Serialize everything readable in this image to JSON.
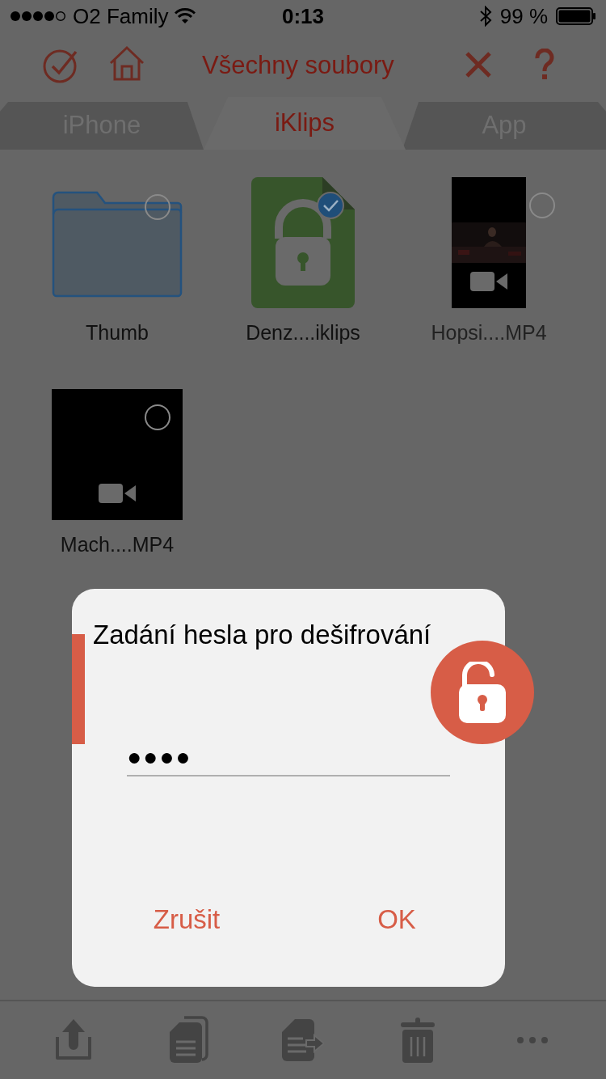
{
  "status_bar": {
    "carrier": "O2 Family",
    "time": "0:13",
    "battery": "99 %"
  },
  "nav": {
    "title": "Všechny soubory"
  },
  "tabs": [
    {
      "label": "iPhone",
      "selected": false
    },
    {
      "label": "iKlips",
      "selected": true
    },
    {
      "label": "App",
      "selected": false
    }
  ],
  "files": [
    {
      "kind": "folder",
      "name": "Thumb",
      "selected": false
    },
    {
      "kind": "locked",
      "name": "Denz....iklips",
      "selected": true
    },
    {
      "kind": "video",
      "name": "Hopsi....MP4",
      "selected": false
    },
    {
      "kind": "video",
      "name": "Mach....MP4",
      "selected": false
    }
  ],
  "dialog": {
    "title": "Zadání hesla pro dešifrování",
    "password": "●●●●",
    "buttons": [
      "Zrušit",
      "OK"
    ]
  }
}
